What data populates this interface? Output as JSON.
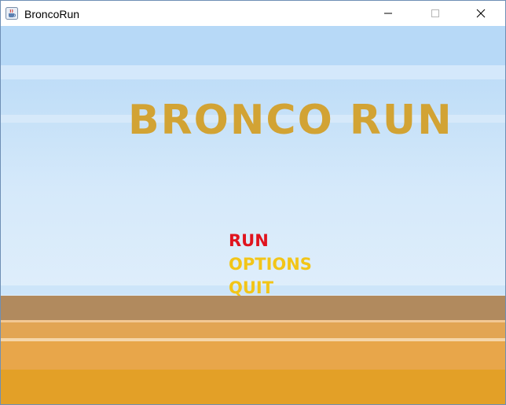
{
  "window": {
    "title": "BroncoRun",
    "icon": "java-coffee-cup-icon",
    "controls": [
      "minimize-icon",
      "maximize-icon",
      "close-icon"
    ]
  },
  "game": {
    "title": "BRONCO RUN",
    "title_color": "#d2a334",
    "menu": {
      "items": [
        {
          "label": "RUN",
          "color": "#e0141e",
          "selected": true
        },
        {
          "label": "OPTIONS",
          "color": "#f2c518",
          "selected": false
        },
        {
          "label": "QUIT",
          "color": "#f2c518",
          "selected": false
        }
      ]
    }
  }
}
